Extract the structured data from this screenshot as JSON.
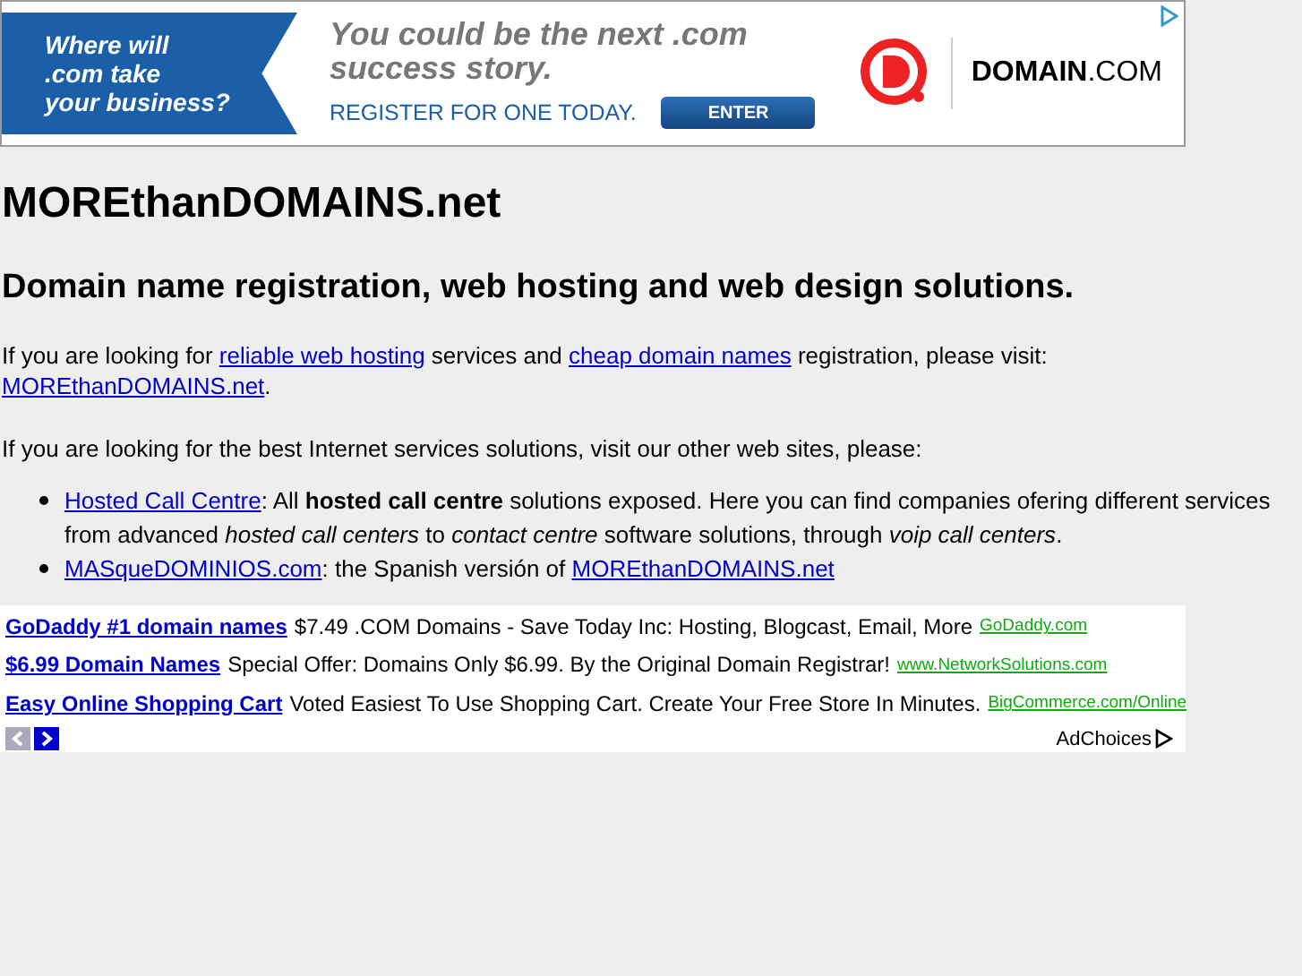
{
  "banner": {
    "tagline": [
      "Where will",
      ".com take",
      "your business?"
    ],
    "headline": [
      "You could be the next .com",
      "success story."
    ],
    "call_to_action": "REGISTER FOR ONE TODAY.",
    "button": "ENTER",
    "logo_text": "DOMAIN",
    "logo_suffix": ".COM"
  },
  "site_title": "MOREthanDOMAINS.net",
  "subtitle": "Domain name registration, web hosting and web design solutions.",
  "paragraphs": [
    [
      {
        "kind": "text",
        "text": "If you are looking for "
      },
      {
        "kind": "link",
        "text": "reliable web hosting"
      },
      {
        "kind": "text",
        "text": " services and "
      },
      {
        "kind": "link",
        "text": "cheap domain names"
      },
      {
        "kind": "text",
        "text": " registration, please visit: "
      },
      {
        "kind": "link",
        "text": "MOREthanDOMAINS.net"
      },
      {
        "kind": "text",
        "text": "."
      }
    ],
    [
      {
        "kind": "text",
        "text": "If you are looking for the best Internet services solutions, visit our other web sites, please:"
      }
    ]
  ],
  "list_items": [
    [
      {
        "kind": "link",
        "text": "Hosted Call Centre"
      },
      {
        "kind": "text",
        "text": ": All "
      },
      {
        "kind": "bold",
        "text": "hosted call centre"
      },
      {
        "kind": "text",
        "text": " solutions exposed. Here you can find companies ofering different services from advanced "
      },
      {
        "kind": "italic",
        "text": "hosted call centers"
      },
      {
        "kind": "text",
        "text": " to "
      },
      {
        "kind": "italic",
        "text": "contact centre"
      },
      {
        "kind": "text",
        "text": " software solutions, through "
      },
      {
        "kind": "italic",
        "text": "voip call centers"
      },
      {
        "kind": "text",
        "text": "."
      }
    ],
    [
      {
        "kind": "link",
        "text": "MASqueDOMINIOS.com"
      },
      {
        "kind": "text",
        "text": ": the Spanish versión of "
      },
      {
        "kind": "link",
        "text": "MOREthanDOMAINS.net"
      }
    ]
  ],
  "text_ads": [
    {
      "title": "GoDaddy #1 domain names",
      "description": "$7.49 .COM Domains - Save Today Inc: Hosting, Blogcast, Email, More",
      "url": "GoDaddy.com"
    },
    {
      "title": "$6.99 Domain Names",
      "description": "Special Offer: Domains Only $6.99. By the Original Domain Registrar!",
      "url": "www.NetworkSolutions.com"
    },
    {
      "title": "Easy Online Shopping Cart",
      "description": "Voted Easiest To Use Shopping Cart. Create Your Free Store In Minutes.",
      "url": "BigCommerce.com/Online"
    }
  ],
  "ad_nav": [
    {
      "kind": "prev",
      "disabled": true
    },
    {
      "kind": "next",
      "disabled": false
    }
  ],
  "adchoices": "AdChoices"
}
